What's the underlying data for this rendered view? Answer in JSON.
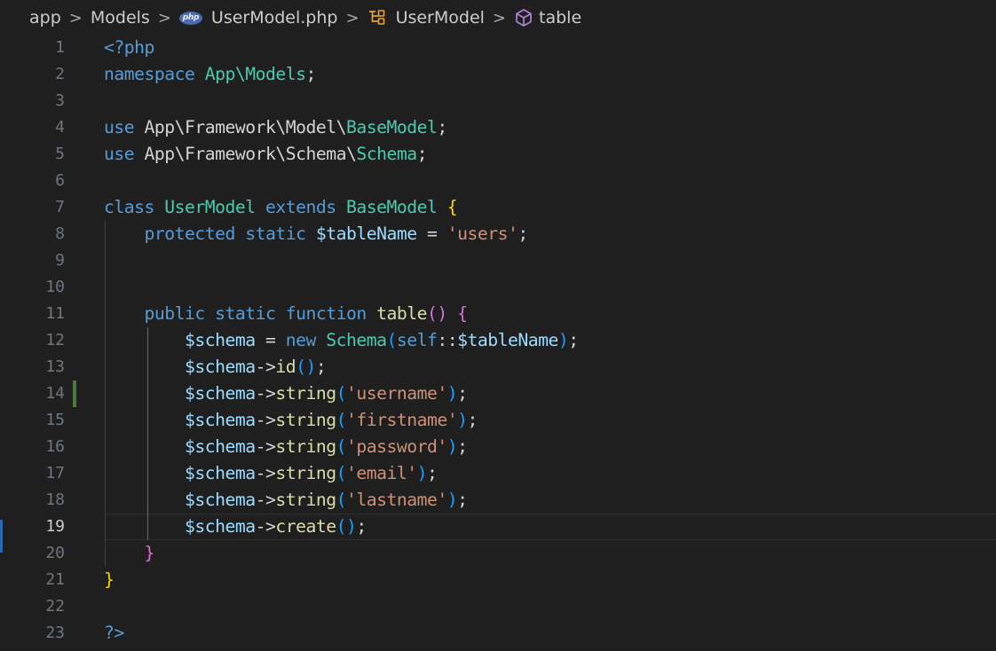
{
  "breadcrumb": {
    "items": [
      {
        "label": "app",
        "icon": ""
      },
      {
        "label": "Models",
        "icon": ""
      },
      {
        "label": "UserModel.php",
        "icon": "php-file-icon",
        "icon_text": "php"
      },
      {
        "label": "UserModel",
        "icon": "class-symbol-icon"
      },
      {
        "label": "table",
        "icon": "method-symbol-icon"
      }
    ],
    "separator": ">"
  },
  "editor": {
    "active_line": 19,
    "modified_line": 14,
    "lines": [
      {
        "n": "1",
        "t": [
          [
            "tag",
            "<?php"
          ]
        ]
      },
      {
        "n": "2",
        "t": [
          [
            "kw",
            "namespace"
          ],
          [
            "plain",
            " "
          ],
          [
            "ns",
            "App\\Models"
          ],
          [
            "plain",
            ";"
          ]
        ]
      },
      {
        "n": "3",
        "t": []
      },
      {
        "n": "4",
        "t": [
          [
            "kw",
            "use"
          ],
          [
            "plain",
            " App\\Framework\\Model\\"
          ],
          [
            "cls",
            "BaseModel"
          ],
          [
            "plain",
            ";"
          ]
        ]
      },
      {
        "n": "5",
        "t": [
          [
            "kw",
            "use"
          ],
          [
            "plain",
            " App\\Framework\\Schema\\"
          ],
          [
            "cls",
            "Schema"
          ],
          [
            "plain",
            ";"
          ]
        ]
      },
      {
        "n": "6",
        "t": []
      },
      {
        "n": "7",
        "t": [
          [
            "kw",
            "class"
          ],
          [
            "plain",
            " "
          ],
          [
            "cls",
            "UserModel"
          ],
          [
            "plain",
            " "
          ],
          [
            "kw",
            "extends"
          ],
          [
            "plain",
            " "
          ],
          [
            "cls",
            "BaseModel"
          ],
          [
            "plain",
            " "
          ],
          [
            "b1",
            "{"
          ]
        ]
      },
      {
        "n": "8",
        "t": [
          [
            "plain",
            "    "
          ],
          [
            "kw",
            "protected"
          ],
          [
            "plain",
            " "
          ],
          [
            "kw",
            "static"
          ],
          [
            "plain",
            " "
          ],
          [
            "var",
            "$tableName"
          ],
          [
            "plain",
            " = "
          ],
          [
            "str",
            "'users'"
          ],
          [
            "plain",
            ";"
          ]
        ]
      },
      {
        "n": "9",
        "t": []
      },
      {
        "n": "10",
        "t": []
      },
      {
        "n": "11",
        "t": [
          [
            "plain",
            "    "
          ],
          [
            "kw",
            "public"
          ],
          [
            "plain",
            " "
          ],
          [
            "kw",
            "static"
          ],
          [
            "plain",
            " "
          ],
          [
            "kw",
            "function"
          ],
          [
            "plain",
            " "
          ],
          [
            "fn",
            "table"
          ],
          [
            "b2",
            "()"
          ],
          [
            "plain",
            " "
          ],
          [
            "b2",
            "{"
          ]
        ]
      },
      {
        "n": "12",
        "t": [
          [
            "plain",
            "        "
          ],
          [
            "var",
            "$schema"
          ],
          [
            "plain",
            " = "
          ],
          [
            "kw",
            "new"
          ],
          [
            "plain",
            " "
          ],
          [
            "cls",
            "Schema"
          ],
          [
            "b3",
            "("
          ],
          [
            "kw",
            "self"
          ],
          [
            "plain",
            "::"
          ],
          [
            "var",
            "$tableName"
          ],
          [
            "b3",
            ")"
          ],
          [
            "plain",
            ";"
          ]
        ]
      },
      {
        "n": "13",
        "t": [
          [
            "plain",
            "        "
          ],
          [
            "var",
            "$schema"
          ],
          [
            "plain",
            "->"
          ],
          [
            "fn",
            "id"
          ],
          [
            "b3",
            "()"
          ],
          [
            "plain",
            ";"
          ]
        ]
      },
      {
        "n": "14",
        "t": [
          [
            "plain",
            "        "
          ],
          [
            "var",
            "$schema"
          ],
          [
            "plain",
            "->"
          ],
          [
            "fn",
            "string"
          ],
          [
            "b3",
            "("
          ],
          [
            "str",
            "'username'"
          ],
          [
            "b3",
            ")"
          ],
          [
            "plain",
            ";"
          ]
        ]
      },
      {
        "n": "15",
        "t": [
          [
            "plain",
            "        "
          ],
          [
            "var",
            "$schema"
          ],
          [
            "plain",
            "->"
          ],
          [
            "fn",
            "string"
          ],
          [
            "b3",
            "("
          ],
          [
            "str",
            "'firstname'"
          ],
          [
            "b3",
            ")"
          ],
          [
            "plain",
            ";"
          ]
        ]
      },
      {
        "n": "16",
        "t": [
          [
            "plain",
            "        "
          ],
          [
            "var",
            "$schema"
          ],
          [
            "plain",
            "->"
          ],
          [
            "fn",
            "string"
          ],
          [
            "b3",
            "("
          ],
          [
            "str",
            "'password'"
          ],
          [
            "b3",
            ")"
          ],
          [
            "plain",
            ";"
          ]
        ]
      },
      {
        "n": "17",
        "t": [
          [
            "plain",
            "        "
          ],
          [
            "var",
            "$schema"
          ],
          [
            "plain",
            "->"
          ],
          [
            "fn",
            "string"
          ],
          [
            "b3",
            "("
          ],
          [
            "str",
            "'email'"
          ],
          [
            "b3",
            ")"
          ],
          [
            "plain",
            ";"
          ]
        ]
      },
      {
        "n": "18",
        "t": [
          [
            "plain",
            "        "
          ],
          [
            "var",
            "$schema"
          ],
          [
            "plain",
            "->"
          ],
          [
            "fn",
            "string"
          ],
          [
            "b3",
            "("
          ],
          [
            "str",
            "'lastname'"
          ],
          [
            "b3",
            ")"
          ],
          [
            "plain",
            ";"
          ]
        ]
      },
      {
        "n": "19",
        "t": [
          [
            "plain",
            "        "
          ],
          [
            "var",
            "$schema"
          ],
          [
            "plain",
            "->"
          ],
          [
            "fn",
            "create"
          ],
          [
            "b3",
            "()"
          ],
          [
            "plain",
            ";"
          ]
        ]
      },
      {
        "n": "20",
        "t": [
          [
            "plain",
            "    "
          ],
          [
            "b2",
            "}"
          ]
        ]
      },
      {
        "n": "21",
        "t": [
          [
            "b1",
            "}"
          ]
        ]
      },
      {
        "n": "22",
        "t": []
      },
      {
        "n": "23",
        "t": [
          [
            "tag",
            "?>"
          ]
        ]
      }
    ]
  },
  "colors": {
    "background": "#1f1f1f",
    "keyword": "#569cd6",
    "class": "#4ec9b0",
    "variable": "#9cdcfe",
    "string": "#ce9178",
    "function": "#dcdcaa",
    "bracket_1": "#ffd700",
    "bracket_2": "#da70d6",
    "bracket_3": "#179fff",
    "git_modified": "#4b7a3b"
  }
}
